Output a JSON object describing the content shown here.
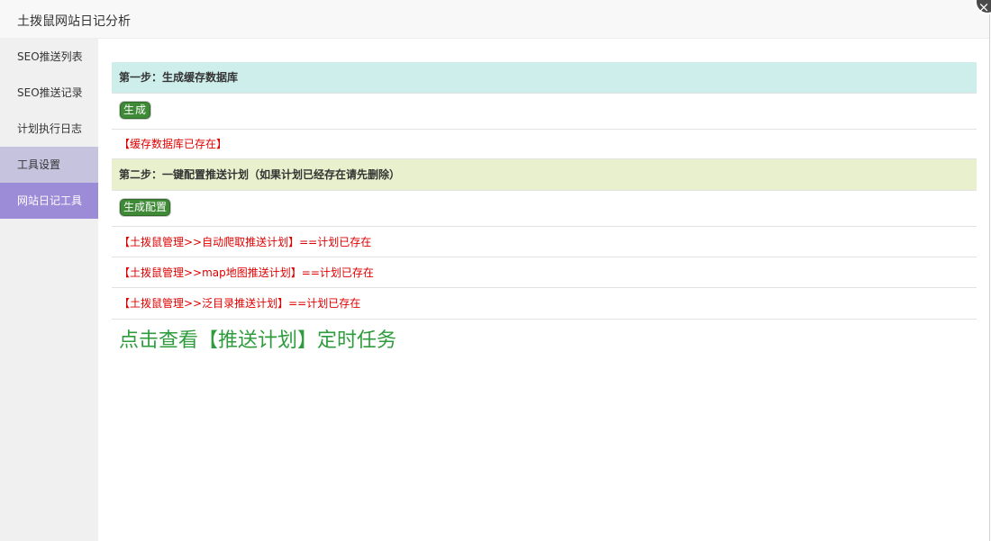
{
  "window": {
    "title": "土拨鼠网站日记分析",
    "close_glyph": "×"
  },
  "sidebar": {
    "items": [
      {
        "label": "SEO推送列表"
      },
      {
        "label": "SEO推送记录"
      },
      {
        "label": "计划执行日志"
      },
      {
        "label": "工具设置"
      },
      {
        "label": "网站日记工具"
      }
    ]
  },
  "main": {
    "step1": {
      "heading": "第一步：生成缓存数据库",
      "button_label": "生成",
      "status": "【缓存数据库已存在】"
    },
    "step2": {
      "heading": "第二步：一键配置推送计划（如果计划已经存在请先删除）",
      "button_label": "生成配置",
      "results": [
        "【土拨鼠管理>>自动爬取推送计划】==计划已存在",
        "【土拨鼠管理>>map地图推送计划】==计划已存在",
        "【土拨鼠管理>>泛目录推送计划】==计划已存在"
      ]
    },
    "view_link": "点击查看【推送计划】定时任务"
  },
  "colors": {
    "step1_bg": "#cdeeea",
    "step2_bg": "#e8f0cd",
    "active_nav": "#9c8bd6",
    "error_text": "#e00000",
    "button_green": "#3e8a36",
    "link_green": "#2e9c3c"
  },
  "icons": {
    "close": "close-icon"
  }
}
